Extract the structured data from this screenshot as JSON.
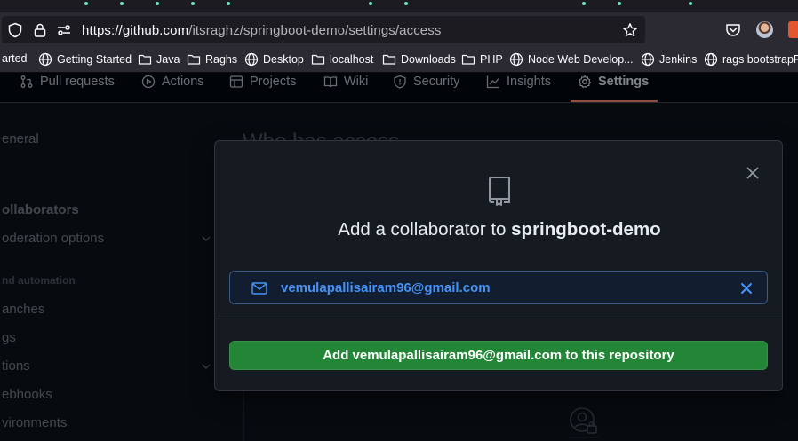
{
  "browser": {
    "url_host": "https://github.com",
    "url_path": "/itsraghz/springboot-demo/settings/access",
    "icons": [
      "shield-icon",
      "lock-icon",
      "site-settings-icon",
      "star-icon",
      "pocket-icon",
      "profile-avatar",
      "extension-icon"
    ]
  },
  "bookmarks": [
    {
      "label": "arted",
      "icon": "none"
    },
    {
      "label": "Getting Started",
      "icon": "globe-icon"
    },
    {
      "label": "Java",
      "icon": "folder-icon"
    },
    {
      "label": "Raghs",
      "icon": "folder-icon"
    },
    {
      "label": "Desktop",
      "icon": "globe-icon"
    },
    {
      "label": "localhost",
      "icon": "folder-icon"
    },
    {
      "label": "Downloads",
      "icon": "folder-icon"
    },
    {
      "label": "PHP",
      "icon": "folder-icon"
    },
    {
      "label": "Node Web Develop...",
      "icon": "globe-icon"
    },
    {
      "label": "Jenkins",
      "icon": "globe-icon"
    },
    {
      "label": "rags bootstrapP",
      "icon": "globe-icon"
    }
  ],
  "repo_nav": {
    "tabs": [
      "Pull requests",
      "Actions",
      "Projects",
      "Wiki",
      "Security",
      "Insights",
      "Settings"
    ],
    "active": "Settings"
  },
  "sidebar": {
    "general": "eneral",
    "collaborators": "ollaborators",
    "moderation": "oderation options",
    "automation_heading": "nd automation",
    "branches": "anches",
    "tags": "gs",
    "actions": "tions",
    "webhooks": "ebhooks",
    "environments": "vironments"
  },
  "main": {
    "heading": "Who has access"
  },
  "modal": {
    "title_prefix": "Add a collaborator to ",
    "repo_name": "springboot-demo",
    "email_value": "vemulapallisairam96@gmail.com",
    "add_button_label": "Add vemulapallisairam96@gmail.com to this repository"
  },
  "colors": {
    "page_bg": "#0d1117",
    "modal_bg": "#161b22",
    "accent_blue": "#4493f8",
    "button_green": "#238636",
    "active_tab_underline": "#f78166"
  }
}
